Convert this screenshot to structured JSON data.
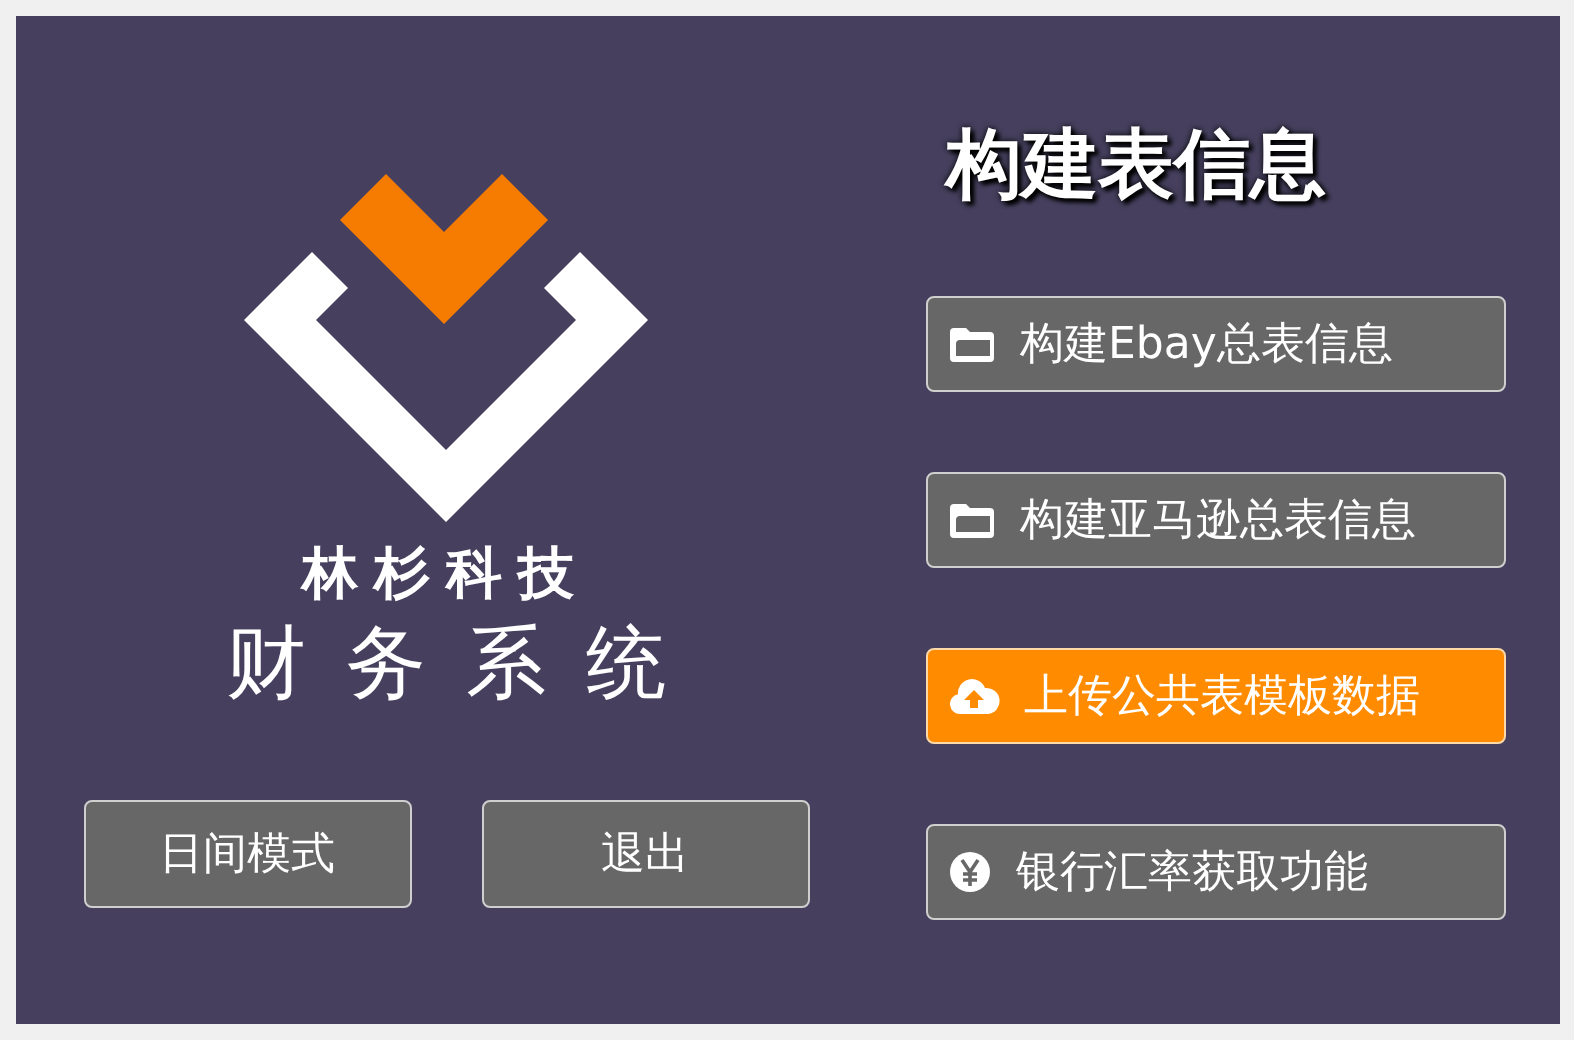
{
  "brand": {
    "company": "林杉科技",
    "product": "财务系统"
  },
  "bottom_buttons": [
    "日间模式",
    "退出"
  ],
  "title": "构建表信息",
  "actions": [
    {
      "label": "构建Ebay总表信息",
      "kind": "folder",
      "highlighted": false
    },
    {
      "label": "构建亚马逊总表信息",
      "kind": "folder",
      "highlighted": false
    },
    {
      "label": "上传公共表模板数据",
      "kind": "upload",
      "highlighted": true
    },
    {
      "label": "银行汇率获取功能",
      "kind": "yen",
      "highlighted": false
    }
  ]
}
